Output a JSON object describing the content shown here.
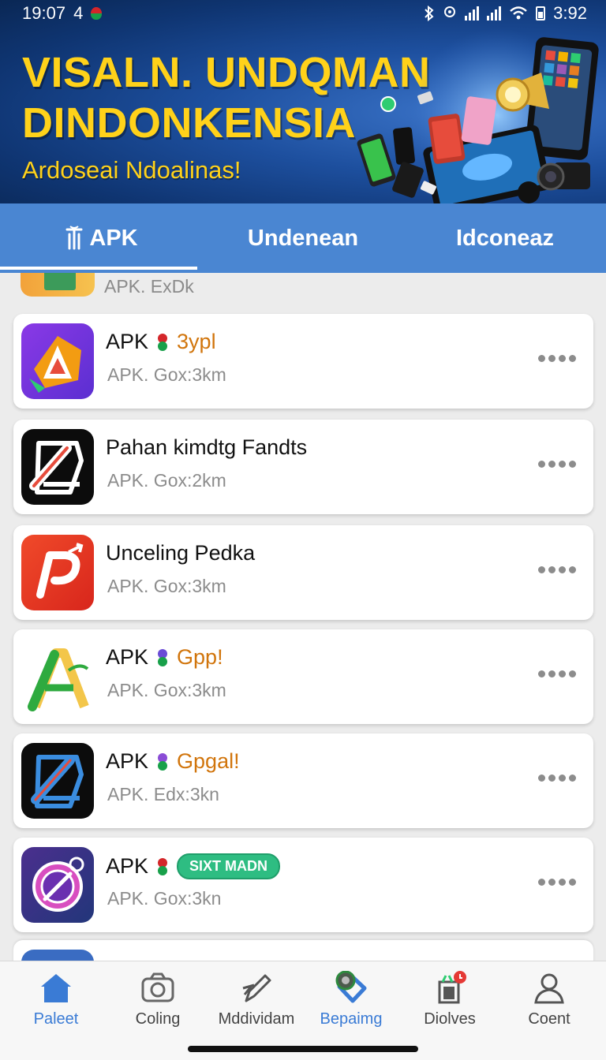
{
  "status_bar": {
    "time_left": "19:07",
    "notif_count": "4",
    "time_right": "3:92"
  },
  "banner": {
    "headline_line1": "VISALN. UNDQMAN",
    "headline_line2": "DINDONKENSIA",
    "subline": "Ardoseai Ndoalinas!"
  },
  "tabs": [
    {
      "label": "APK",
      "active": true
    },
    {
      "label": "Undenean",
      "active": false
    },
    {
      "label": "Idconeaz",
      "active": false
    }
  ],
  "list": {
    "peek_top_text": "APK.   ExDk",
    "items": [
      {
        "title": "APK",
        "tag": "3ypl",
        "pill": "",
        "sub": "APK.  Gox:3km",
        "icon": "orange-triangle-icon"
      },
      {
        "title": "Pahan kimdtg Fandts",
        "tag": "",
        "pill": "",
        "sub": "APK.  Gox:2km",
        "icon": "pencil-box-icon"
      },
      {
        "title": "Unceling Pedka",
        "tag": "",
        "pill": "",
        "sub": "APK.  Gox:3km",
        "icon": "red-p-logo-icon"
      },
      {
        "title": "APK",
        "tag": "Gpp!",
        "pill": "",
        "sub": "APK.  Gox:3km",
        "icon": "green-a-logo-icon"
      },
      {
        "title": "APK",
        "tag": "Gpgal!",
        "pill": "",
        "sub": "APK.  Edx:3kn",
        "icon": "blue-pencil-box-icon"
      },
      {
        "title": "APK",
        "tag": "",
        "pill": "SIXT MADN",
        "sub": "APK.  Gox:3kn",
        "icon": "purple-compass-icon"
      }
    ]
  },
  "bottom_nav": [
    {
      "label": "Paleet",
      "icon": "home-icon",
      "active": true
    },
    {
      "label": "Coling",
      "icon": "camera-icon",
      "active": false
    },
    {
      "label": "Mddividam",
      "icon": "pen-icon",
      "active": false
    },
    {
      "label": "Bepaimg",
      "icon": "diamond-icon",
      "active": true
    },
    {
      "label": "Diolves",
      "icon": "gift-box-icon",
      "active": false
    },
    {
      "label": "Coent",
      "icon": "profile-icon",
      "active": false
    }
  ],
  "colors": {
    "tab_bar": "#4a86d2",
    "headline": "#ffd21a",
    "accent_blue": "#3a7bd5",
    "tag_orange": "#d1750c",
    "pill_green": "#2ebd82"
  }
}
